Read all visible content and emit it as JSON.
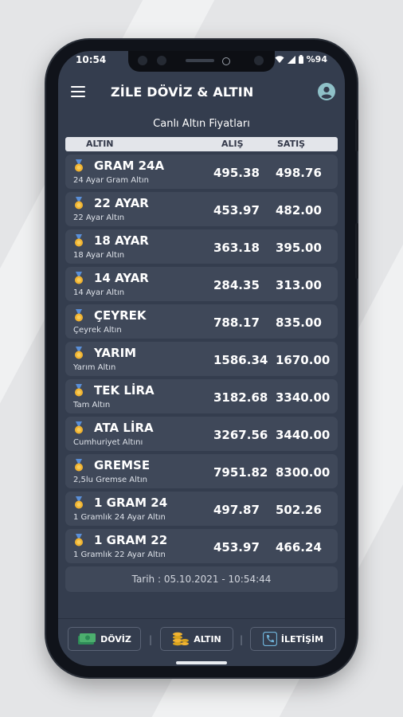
{
  "status_bar": {
    "time": "10:54",
    "battery": "%94"
  },
  "app_bar": {
    "title": "ZİLE DÖVİZ & ALTIN",
    "menu_icon": "hamburger-menu-icon",
    "profile_icon": "account-circle-icon"
  },
  "subtitle": "Canlı Altın Fiyatları",
  "table_header": {
    "name": "ALTIN",
    "buy": "ALIŞ",
    "sell": "SATIŞ"
  },
  "rows": [
    {
      "name": "GRAM 24A",
      "desc": "24 Ayar Gram Altın",
      "buy": "495.38",
      "sell": "498.76"
    },
    {
      "name": "22 AYAR",
      "desc": "22 Ayar Altın",
      "buy": "453.97",
      "sell": "482.00"
    },
    {
      "name": "18 AYAR",
      "desc": "18 Ayar Altın",
      "buy": "363.18",
      "sell": "395.00"
    },
    {
      "name": "14 AYAR",
      "desc": "14 Ayar Altın",
      "buy": "284.35",
      "sell": "313.00"
    },
    {
      "name": "ÇEYREK",
      "desc": "Çeyrek Altın",
      "buy": "788.17",
      "sell": "835.00"
    },
    {
      "name": "YARIM",
      "desc": "Yarım Altın",
      "buy": "1586.34",
      "sell": "1670.00"
    },
    {
      "name": "TEK LİRA",
      "desc": "Tam Altın",
      "buy": "3182.68",
      "sell": "3340.00"
    },
    {
      "name": "ATA LİRA",
      "desc": "Cumhuriyet Altını",
      "buy": "3267.56",
      "sell": "3440.00"
    },
    {
      "name": "GREMSE",
      "desc": "2,5lu Gremse Altın",
      "buy": "7951.82",
      "sell": "8300.00"
    },
    {
      "name": "1 GRAM 24",
      "desc": "1 Gramlık 24 Ayar Altın",
      "buy": "497.87",
      "sell": "502.26"
    },
    {
      "name": "1 GRAM 22",
      "desc": "1 Gramlık 22 Ayar Altın",
      "buy": "453.97",
      "sell": "466.24"
    }
  ],
  "date_line": "Tarih : 05.10.2021 - 10:54:44",
  "bottom_nav": [
    {
      "label": "DÖVİZ",
      "icon": "money-icon"
    },
    {
      "label": "ALTIN",
      "icon": "coins-icon"
    },
    {
      "label": "İLETİŞİM",
      "icon": "phone-icon"
    }
  ],
  "colors": {
    "screen_bg": "#343d4e",
    "row_bg": "#3f4859",
    "header_bg": "#e3e5ea",
    "medal_gold": "#f2b431",
    "ribbon": "#5a8fd8"
  }
}
